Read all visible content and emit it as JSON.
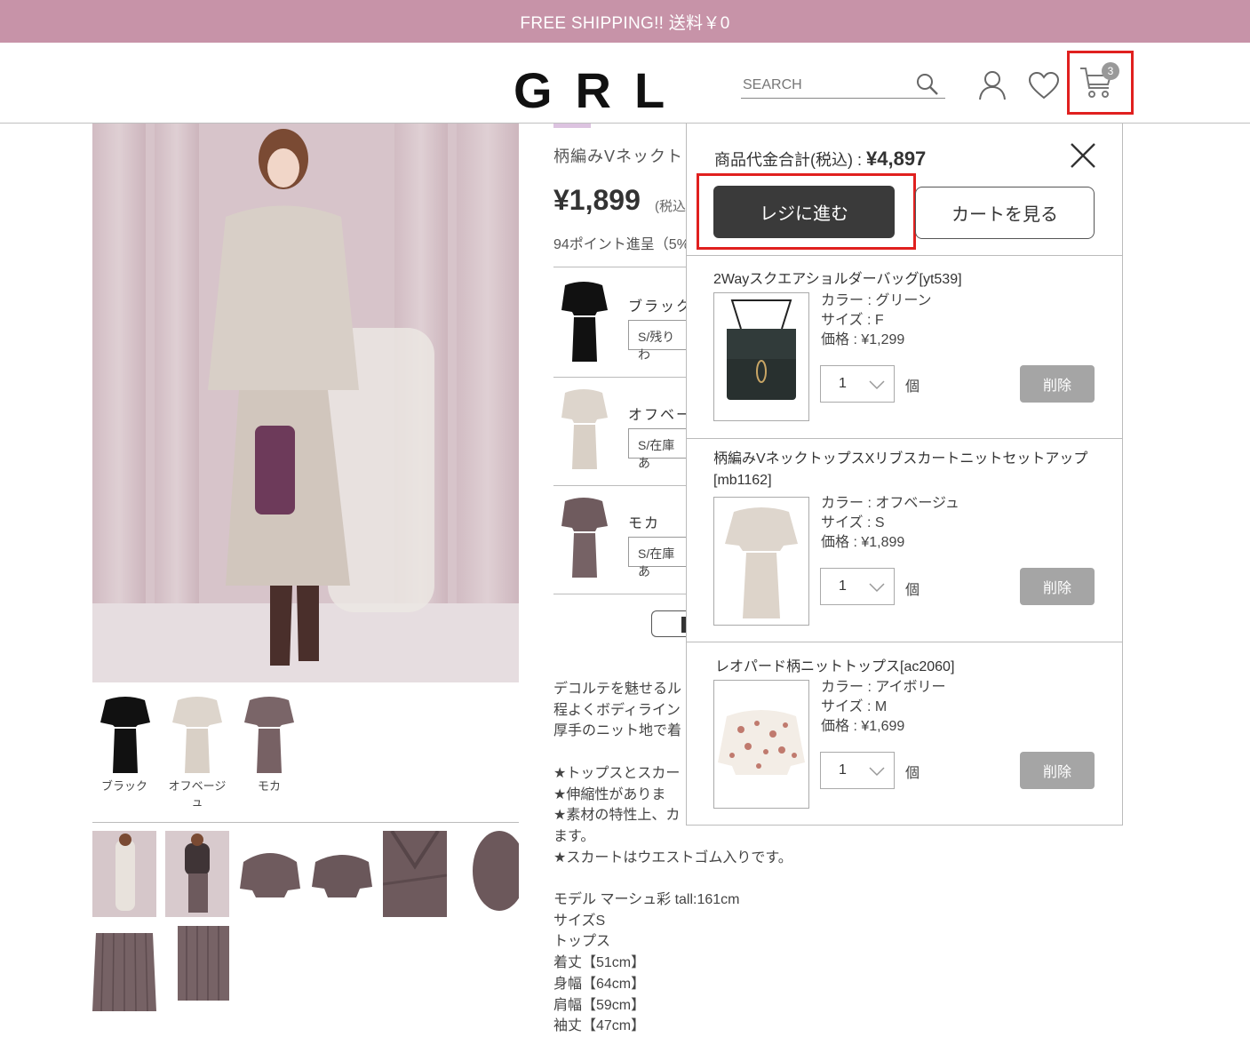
{
  "banner": {
    "text": "FREE SHIPPING!! 送料￥0"
  },
  "header": {
    "logo": "GRL",
    "search_placeholder": "SEARCH",
    "cart_count": "3"
  },
  "product": {
    "title": "柄編みVネックト",
    "price": "¥1,899",
    "tax": "(税込",
    "points": "94ポイント進呈（5%",
    "variants": [
      {
        "name": "ブラック",
        "select": "S/残りわ"
      },
      {
        "name": "オフベー",
        "select": "S/在庫あ"
      },
      {
        "name": "モカ",
        "select": "S/在庫あ"
      }
    ],
    "color_thumbs": [
      "ブラック",
      "オフベージ",
      "ュ",
      "モカ"
    ],
    "description": [
      "デコルテを魅せるル",
      "程よくボディライン",
      "厚手のニット地で着",
      "",
      "★トップスとスカー",
      "★伸縮性がありま",
      "★素材の特性上、カ",
      "ます。",
      "★スカートはウエストゴム入りです。",
      "",
      "モデル マーシュ彩 tall:161cm",
      "サイズS",
      "トップス",
      "着丈【51cm】",
      "身幅【64cm】",
      "肩幅【59cm】",
      "袖丈【47cm】"
    ]
  },
  "cart": {
    "total_label": "商品代金合計(税込) : ",
    "total_value": "¥4,897",
    "checkout_label": "レジに進む",
    "view_cart_label": "カートを見る",
    "qty_unit": "個",
    "delete_label": "削除",
    "items": [
      {
        "name": "2Wayスクエアショルダーバッグ[yt539]",
        "color": "カラー : グリーン",
        "size": "サイズ : F",
        "price": "価格 : ¥1,299",
        "qty": "1"
      },
      {
        "name": "柄編みVネックトップスXリブスカートニットセットアップ[mb1162]",
        "color": "カラー : オフベージュ",
        "size": "サイズ : S",
        "price": "価格 : ¥1,899",
        "qty": "1"
      },
      {
        "name": "レオパード柄ニットトップス[ac2060]",
        "color": "カラー : アイボリー",
        "size": "サイズ : M",
        "price": "価格 : ¥1,699",
        "qty": "1"
      }
    ]
  },
  "colors": {
    "banner": "#c793a8",
    "highlight": "#e0201f",
    "dark_button": "#3a3a3a",
    "delete_button": "#a5a5a5"
  },
  "icons": [
    "search-icon",
    "account-icon",
    "heart-icon",
    "cart-icon",
    "close-icon",
    "chevron-down-icon"
  ]
}
